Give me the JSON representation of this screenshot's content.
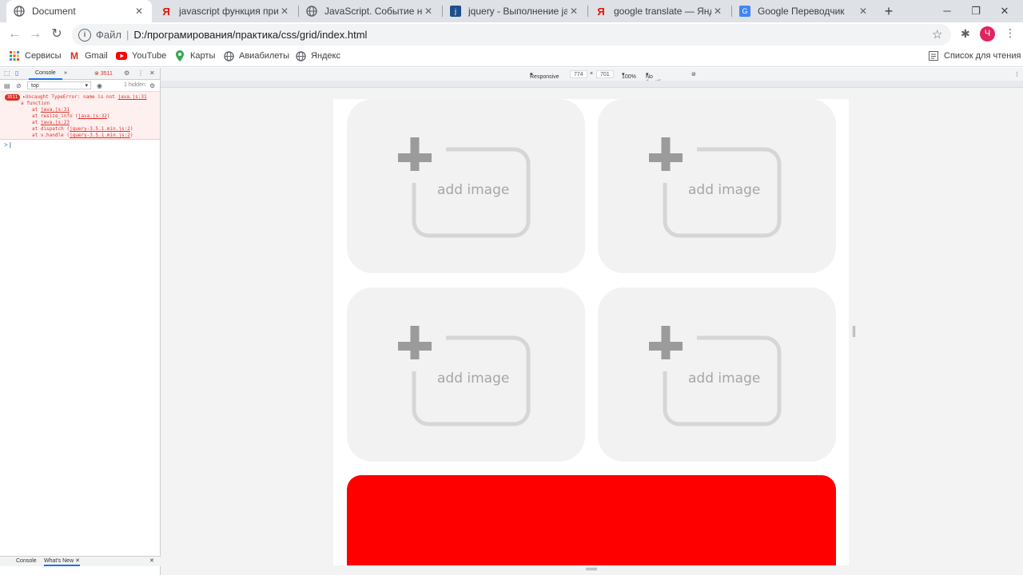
{
  "browser": {
    "tabs": [
      {
        "title": "Document",
        "icon": "globe-icon",
        "active": true
      },
      {
        "title": "javascript функция при изме",
        "icon": "yandex-icon",
        "active": false
      },
      {
        "title": "JavaScript. Событие на изме",
        "icon": "globe-icon",
        "active": false
      },
      {
        "title": "jquery - Выполнение javascr",
        "icon": "jquery-icon",
        "active": false
      },
      {
        "title": "google translate — Яндекс: н",
        "icon": "yandex-icon",
        "active": false
      },
      {
        "title": "Google Переводчик",
        "icon": "google-translate-icon",
        "active": false
      }
    ],
    "new_tab_label": "+",
    "address": {
      "scheme_label": "Файл",
      "url": "D:/програмирования/практика/css/grid/index.html"
    },
    "avatar_letter": "Ч",
    "bookmarks": [
      {
        "label": "Сервисы",
        "icon": "apps-grid-icon"
      },
      {
        "label": "Gmail",
        "icon": "gmail-icon"
      },
      {
        "label": "YouTube",
        "icon": "youtube-icon"
      },
      {
        "label": "Карты",
        "icon": "maps-icon"
      },
      {
        "label": "Авиабилеты",
        "icon": "globe-icon"
      },
      {
        "label": "Яндекс",
        "icon": "globe-icon"
      }
    ],
    "reading_list_label": "Список для чтения"
  },
  "devtools": {
    "active_tab": "Console",
    "more_tabs": "»",
    "error_count": "3511",
    "context": "top",
    "hidden_label": "1 hidden",
    "error": {
      "count": "3511",
      "line1": "Uncaught TypeError: name is not",
      "line1_link": "java.js:31",
      "line2": "a function",
      "stack": [
        {
          "prefix": "at ",
          "link": "java.js:31",
          "suffix": ""
        },
        {
          "prefix": "at resize_info (",
          "link": "java.js:32",
          "suffix": ")"
        },
        {
          "prefix": "at ",
          "link": "java.js:23",
          "suffix": ""
        },
        {
          "prefix": "at dispatch (",
          "link": "jquery-3.5.1.min.js:2",
          "suffix": ")"
        },
        {
          "prefix": "at v.handle (",
          "link": "jquery-3.5.1.min.js:2",
          "suffix": ")"
        }
      ]
    },
    "prompt": ">",
    "drawer_tabs": [
      "Console",
      "What's New"
    ]
  },
  "device_toolbar": {
    "mode": "Responsive",
    "width": "774",
    "times": "×",
    "height": "701",
    "zoom": "100%",
    "throttling": "No throttling"
  },
  "page": {
    "cards": [
      {
        "label": "add image"
      },
      {
        "label": "add image"
      },
      {
        "label": "add image"
      },
      {
        "label": "add image"
      }
    ],
    "accent_color": "#ff0000",
    "card_color": "#f2f2f2"
  }
}
